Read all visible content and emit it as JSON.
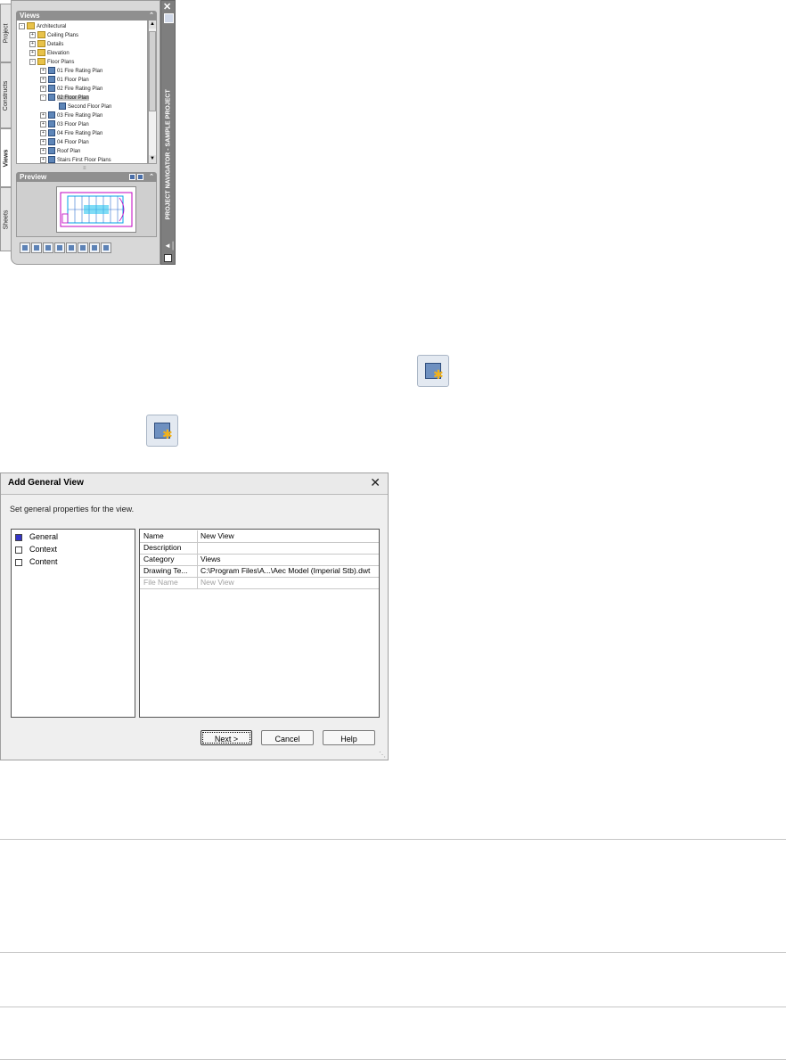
{
  "navigator": {
    "title": "PROJECT NAVIGATOR - SAMPLE PROJECT",
    "tabs": [
      "Project",
      "Constructs",
      "Views",
      "Sheets"
    ],
    "active_tab": "Views",
    "views_header": "Views",
    "preview_header": "Preview",
    "tree": [
      {
        "label": "Architectural",
        "depth": 0,
        "type": "folder",
        "expander": "-"
      },
      {
        "label": "Ceiling Plans",
        "depth": 1,
        "type": "folder",
        "expander": "+"
      },
      {
        "label": "Details",
        "depth": 1,
        "type": "folder",
        "expander": "+"
      },
      {
        "label": "Elevation",
        "depth": 1,
        "type": "folder",
        "expander": "+"
      },
      {
        "label": "Floor Plans",
        "depth": 1,
        "type": "folder",
        "expander": "-"
      },
      {
        "label": "01 Fire Rating Plan",
        "depth": 2,
        "type": "view",
        "expander": "+"
      },
      {
        "label": "01 Floor Plan",
        "depth": 2,
        "type": "view",
        "expander": "+"
      },
      {
        "label": "02 Fire Rating Plan",
        "depth": 2,
        "type": "view",
        "expander": "+"
      },
      {
        "label": "02 Floor Plan",
        "depth": 2,
        "type": "view",
        "expander": "-",
        "selected": true
      },
      {
        "label": "Second Floor Plan",
        "depth": 3,
        "type": "view",
        "expander": ""
      },
      {
        "label": "03 Fire Rating Plan",
        "depth": 2,
        "type": "view",
        "expander": "+"
      },
      {
        "label": "03 Floor Plan",
        "depth": 2,
        "type": "view",
        "expander": "+"
      },
      {
        "label": "04 Fire Rating Plan",
        "depth": 2,
        "type": "view",
        "expander": "+"
      },
      {
        "label": "04 Floor Plan",
        "depth": 2,
        "type": "view",
        "expander": "+"
      },
      {
        "label": "Roof Plan",
        "depth": 2,
        "type": "view",
        "expander": "+"
      },
      {
        "label": "Stairs First Floor Plans",
        "depth": 2,
        "type": "view",
        "expander": "+"
      }
    ],
    "toolbar_icons": [
      "add-view-icon",
      "add-detail-view-icon",
      "add-section-view-icon",
      "regenerate-icon",
      "repath-icon",
      "schedule-icon",
      "add-sheet-icon",
      "publish-icon"
    ]
  },
  "dialog": {
    "title": "Add General View",
    "instruction": "Set general properties for the view.",
    "categories": [
      {
        "label": "General",
        "checked": true
      },
      {
        "label": "Context",
        "checked": false
      },
      {
        "label": "Content",
        "checked": false
      }
    ],
    "properties": [
      {
        "name": "Name",
        "value": "New View",
        "disabled": false
      },
      {
        "name": "Description",
        "value": "",
        "disabled": false
      },
      {
        "name": "Category",
        "value": "Views",
        "disabled": false
      },
      {
        "name": "Drawing Te...",
        "value": "C:\\Program Files\\A...\\Aec Model (Imperial Stb).dwt",
        "disabled": false
      },
      {
        "name": "File Name",
        "value": "New View",
        "disabled": true
      }
    ],
    "buttons": {
      "next": "Next >",
      "cancel": "Cancel",
      "help": "Help"
    }
  },
  "colors": {
    "accent": "#3535c8",
    "palette_bg": "#d8d8d8",
    "header_bg": "#8f8f8f"
  }
}
